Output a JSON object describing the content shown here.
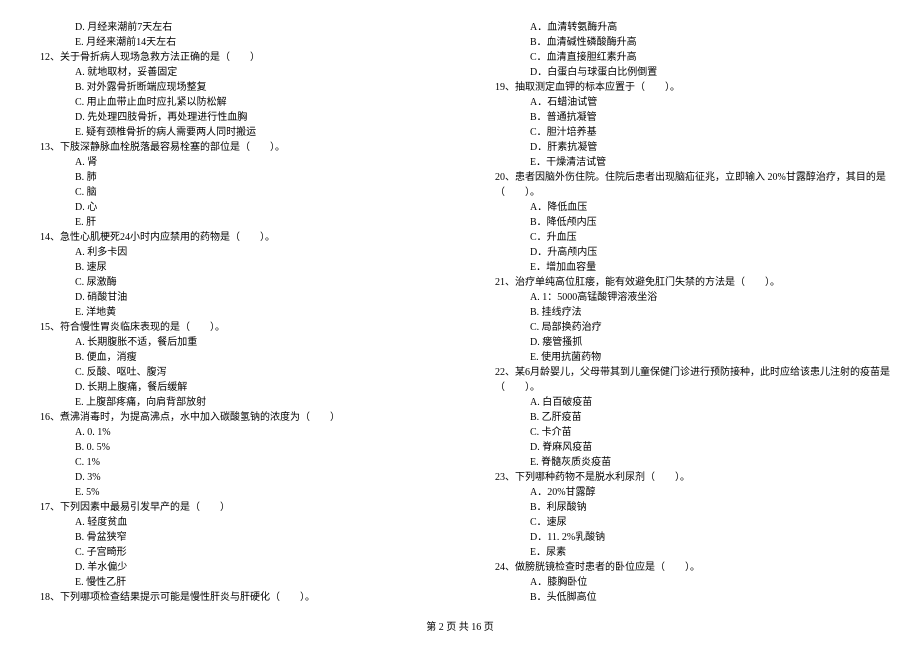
{
  "left": {
    "opt_d_11": "D. 月经来潮前7天左右",
    "opt_e_11": "E. 月经来潮前14天左右",
    "q12": "12、关于骨折病人现场急救方法正确的是（　　）",
    "q12_a": "A. 就地取材，妥善固定",
    "q12_b": "B. 对外露骨折断端应现场整复",
    "q12_c": "C. 用止血带止血时应扎紧以防松解",
    "q12_d": "D. 先处理四肢骨折，再处理进行性血胸",
    "q12_e": "E. 疑有颈椎骨折的病人需要两人同时搬运",
    "q13": "13、下肢深静脉血栓脱落最容易栓塞的部位是（　　）。",
    "q13_a": "A. 肾",
    "q13_b": "B. 肺",
    "q13_c": "C. 脑",
    "q13_d": "D. 心",
    "q13_e": "E. 肝",
    "q14": "14、急性心肌梗死24小时内应禁用的药物是（　　）。",
    "q14_a": "A. 利多卡因",
    "q14_b": "B. 速尿",
    "q14_c": "C. 尿激酶",
    "q14_d": "D. 硝酸甘油",
    "q14_e": "E. 洋地黄",
    "q15": "15、符合慢性胃炎临床表现的是（　　）。",
    "q15_a": "A. 长期腹胀不适，餐后加重",
    "q15_b": "B. 便血，消瘦",
    "q15_c": "C. 反酸、呕吐、腹泻",
    "q15_d": "D. 长期上腹痛，餐后缓解",
    "q15_e": "E. 上腹部疼痛，向肩背部放射",
    "q16": "16、煮沸消毒时，为提高沸点，水中加入碳酸氢钠的浓度为（　　）",
    "q16_a": "A. 0. 1%",
    "q16_b": "B. 0. 5%",
    "q16_c": "C. 1%",
    "q16_d": "D. 3%",
    "q16_e": "E. 5%",
    "q17": "17、下列因素中最易引发早产的是（　　）",
    "q17_a": "A. 轻度贫血",
    "q17_b": "B. 骨盆狭窄",
    "q17_c": "C. 子宫畸形",
    "q17_d": "D. 羊水偏少",
    "q17_e": "E. 慢性乙肝",
    "q18": "18、下列哪项检查结果提示可能是慢性肝炎与肝硬化（　　）。"
  },
  "right": {
    "q18_a": "A．血清转氨酶升高",
    "q18_b": "B．血清碱性磷酸酶升高",
    "q18_c": "C．血清直接胆红素升高",
    "q18_d": "D．白蛋白与球蛋白比例倒置",
    "q19": "19、抽取测定血钾的标本应置于（　　）。",
    "q19_a": "A．石蜡油试管",
    "q19_b": "B．普通抗凝管",
    "q19_c": "C．胆汁培养基",
    "q19_d": "D．肝素抗凝管",
    "q19_e": "E．干燥清洁试管",
    "q20": "20、患者因脑外伤住院。住院后患者出现脑疝征兆，立即输入 20%甘露醇治疗，其目的是（　　）。",
    "q20_a": "A．降低血压",
    "q20_b": "B．降低颅内压",
    "q20_c": "C．升血压",
    "q20_d": "D．升高颅内压",
    "q20_e": "E．增加血容量",
    "q21": "21、治疗单纯高位肛瘘，能有效避免肛门失禁的方法是（　　）。",
    "q21_a": "A. 1：5000高锰酸钾溶液坐浴",
    "q21_b": "B. 挂线疗法",
    "q21_c": "C. 局部换药治疗",
    "q21_d": "D. 瘘管搔抓",
    "q21_e": "E. 使用抗菌药物",
    "q22": "22、某6月龄婴儿，父母带其到儿童保健门诊进行预防接种，此时应给该患儿注射的疫苗是（　　）。",
    "q22_a": "A. 白百破疫苗",
    "q22_b": "B. 乙肝疫苗",
    "q22_c": "C. 卡介苗",
    "q22_d": "D. 脊麻风疫苗",
    "q22_e": "E. 脊髓灰质炎疫苗",
    "q23": "23、下列哪种药物不是脱水利尿剂（　　）。",
    "q23_a": "A．20%甘露醇",
    "q23_b": "B．利尿酸钠",
    "q23_c": "C．速尿",
    "q23_d": "D．11. 2%乳酸钠",
    "q23_e": "E．尿素",
    "q24": "24、做膀胱镜检查时患者的卧位应是（　　）。",
    "q24_a": "A．膝胸卧位",
    "q24_b": "B．头低脚高位"
  },
  "footer": "第 2 页 共 16 页"
}
